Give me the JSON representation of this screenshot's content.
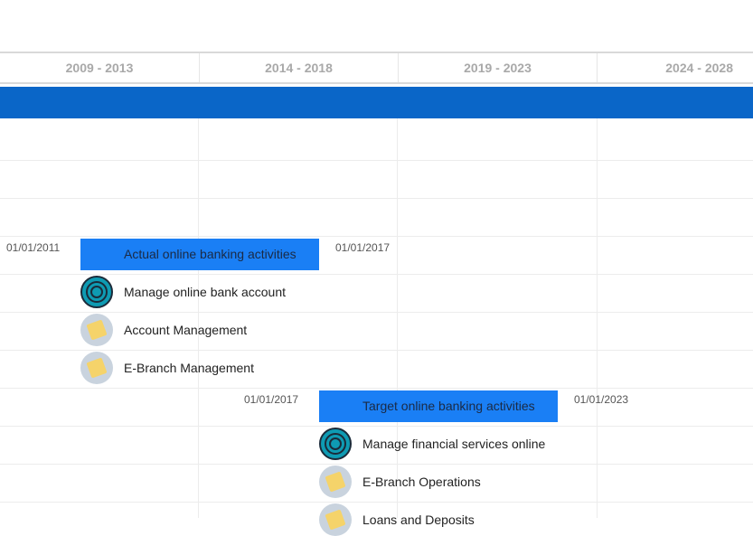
{
  "timeline": {
    "periods": [
      "2009 - 2013",
      "2014 - 2018",
      "2019 - 2023",
      "2024 - 2028"
    ]
  },
  "colors": {
    "band": "#0a66c8",
    "bar": "#1a7ff5",
    "target_icon": "#0e9bb3",
    "task_icon_bg": "#c9d3de",
    "task_icon_fg": "#f5d36a"
  },
  "groups": [
    {
      "start_date": "01/01/2011",
      "end_date": "01/01/2017",
      "label": "Actual online banking activities",
      "items": [
        {
          "icon": "target-icon",
          "label": "Manage online bank account"
        },
        {
          "icon": "task-icon",
          "label": "Account Management"
        },
        {
          "icon": "task-icon",
          "label": "E-Branch Management"
        }
      ]
    },
    {
      "start_date": "01/01/2017",
      "end_date": "01/01/2023",
      "label": "Target online banking activities",
      "items": [
        {
          "icon": "target-icon",
          "label": "Manage financial services online"
        },
        {
          "icon": "task-icon",
          "label": "E-Branch Operations"
        },
        {
          "icon": "task-icon",
          "label": "Loans and Deposits"
        }
      ]
    }
  ]
}
